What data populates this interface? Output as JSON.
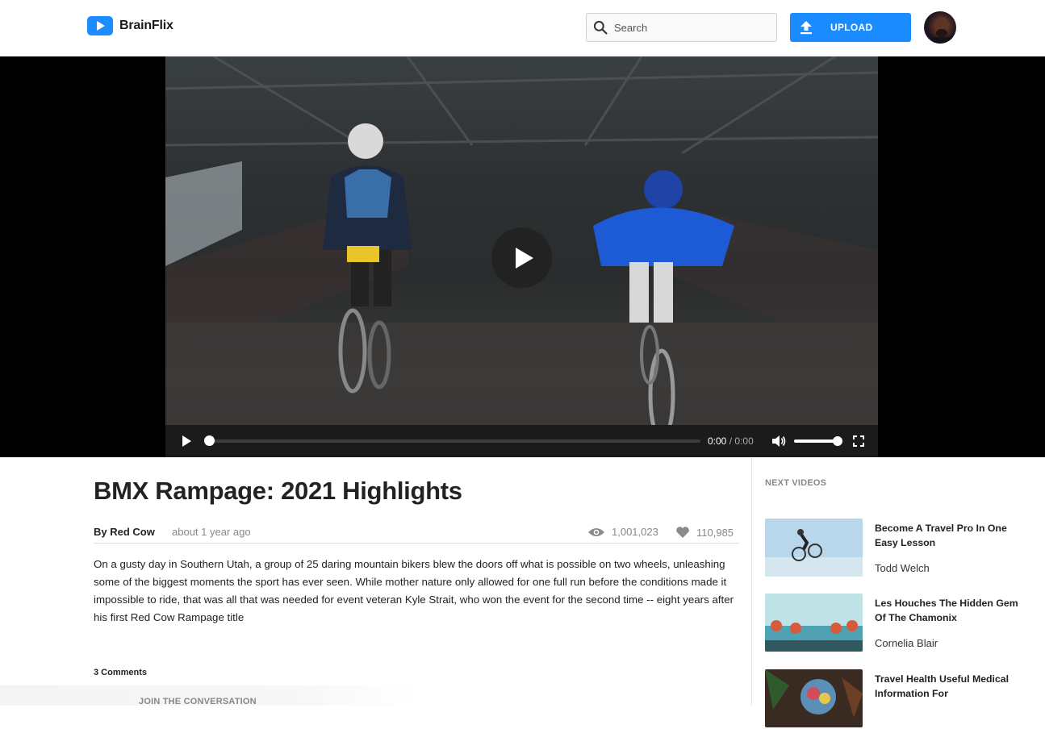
{
  "header": {
    "brand": "BrainFlix",
    "search_placeholder": "Search",
    "upload_label": "UPLOAD",
    "accent_color": "#1a8cff"
  },
  "player": {
    "current_time": "0:00",
    "separator": "/",
    "duration": "0:00",
    "progress": 0,
    "volume": 1.0
  },
  "video": {
    "title": "BMX Rampage: 2021 Highlights",
    "byline": "By Red Cow",
    "posted": "about 1 year ago",
    "views": "1,001,023",
    "likes": "110,985",
    "description": "On a gusty day in Southern Utah, a group of 25 daring mountain bikers blew the doors off what is possible on two wheels, unleashing some of the biggest moments the sport has ever seen. While mother nature only allowed for one full run before the conditions made it impossible to ride, that was all that was needed for event veteran Kyle Strait, who won the event for the second time -- eight years after his first Red Cow Rampage title"
  },
  "comments": {
    "count_label": "3 Comments",
    "join_label": "JOIN THE CONVERSATION"
  },
  "sidebar": {
    "heading": "NEXT VIDEOS",
    "items": [
      {
        "title": "Become A Travel Pro In One Easy Lesson",
        "author": "Todd Welch"
      },
      {
        "title": "Les Houches The Hidden Gem Of The Chamonix",
        "author": "Cornelia Blair"
      },
      {
        "title": "Travel Health Useful Medical Information For",
        "author": ""
      }
    ]
  },
  "icons": {
    "search": "search-icon",
    "upload": "upload-icon",
    "play": "play-icon",
    "volume": "volume-icon",
    "fullscreen": "fullscreen-icon",
    "views": "eye-icon",
    "likes": "heart-icon"
  }
}
